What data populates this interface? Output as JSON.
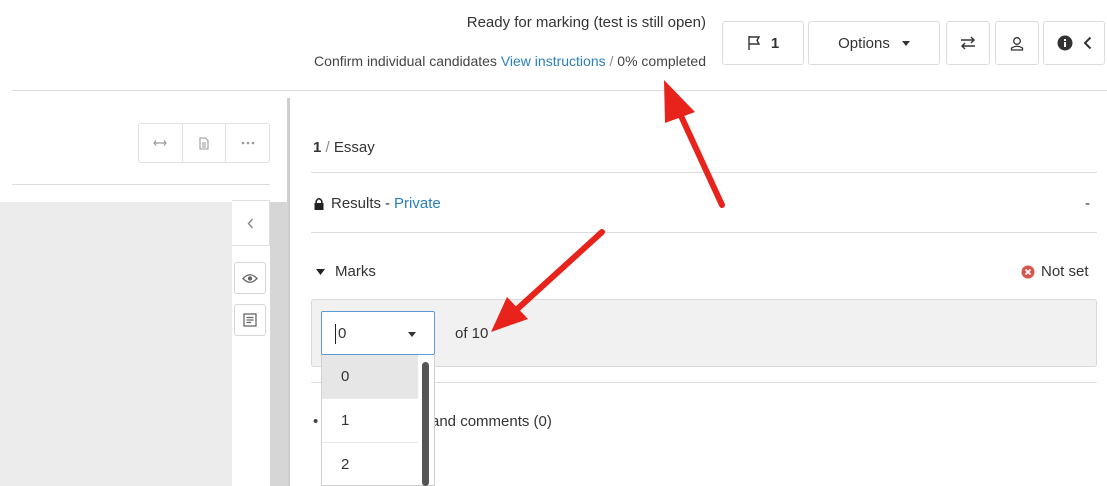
{
  "header": {
    "status_title": "Ready for marking (test is still open)",
    "confirm_text": "Confirm individual candidates",
    "view_instructions": "View instructions",
    "separator": "/",
    "progress_text": "0% completed",
    "progress_percent": 0
  },
  "toolbar": {
    "flag_count": "1",
    "options_label": "Options",
    "icons": [
      "flag-icon",
      "chevron-down-icon",
      "swap-icon",
      "user-icon",
      "info-icon",
      "chevron-left-icon"
    ]
  },
  "left_panel": {
    "icons": [
      "expand-horizontal-icon",
      "document-icon",
      "more-icon",
      "chevron-left-icon",
      "eye-icon",
      "notes-icon"
    ]
  },
  "question": {
    "number": "1",
    "separator": "/",
    "type": "Essay"
  },
  "results": {
    "label": "Results",
    "dash": "-",
    "visibility": "Private",
    "value": "-"
  },
  "marks": {
    "label": "Marks",
    "status": "Not set",
    "status_color": "#d9534f",
    "selected_value": "0",
    "of_text": "of 10",
    "options": [
      "0",
      "1",
      "2"
    ]
  },
  "comments": {
    "label_visible": "and comments (0)"
  },
  "colors": {
    "link": "#2a7fc1",
    "annotation_arrow": "#e8231c",
    "focus_border": "#5b9bd5"
  }
}
